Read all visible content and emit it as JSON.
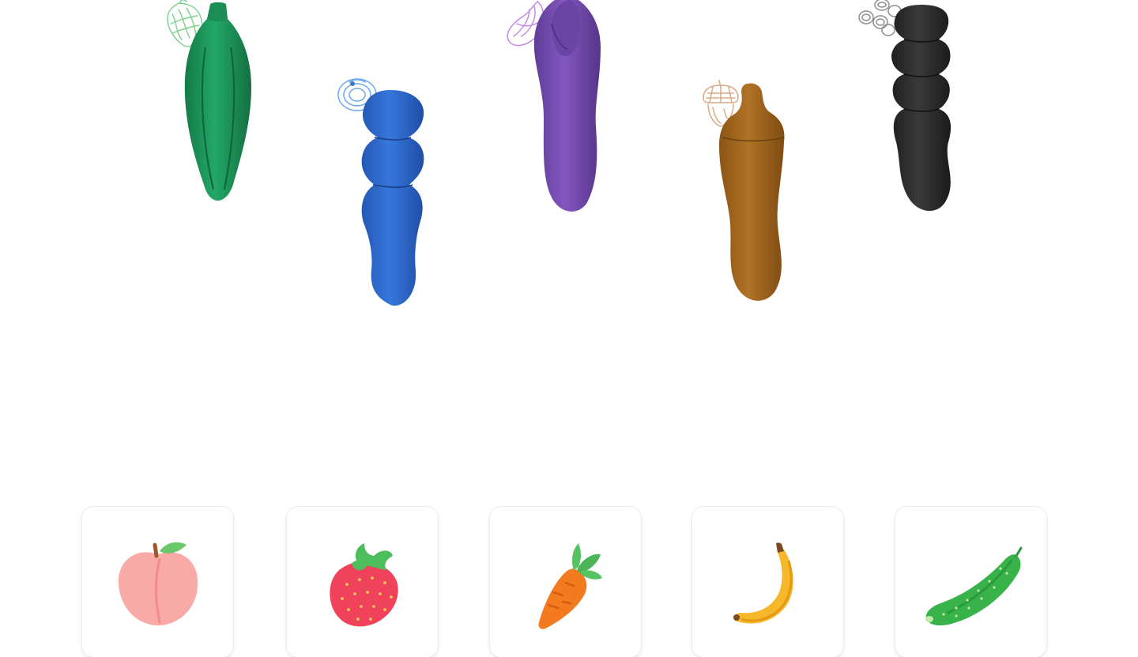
{
  "colors": {
    "green": "#1f9a5f",
    "blue": "#2e6fd1",
    "purple": "#7a4fb0",
    "brown": "#a8691e",
    "black": "#2b2b2b",
    "peach": "#f9a9a6",
    "strawberry": "#f0425a",
    "carrot": "#f47a20",
    "banana": "#f7b72a",
    "cucumber": "#37b34a"
  },
  "products": [
    {
      "icon": "pepper-doodle-icon",
      "color": "green"
    },
    {
      "icon": "blueberry-doodle-icon",
      "color": "blue"
    },
    {
      "icon": "eggplant-doodle-icon",
      "color": "purple"
    },
    {
      "icon": "acorn-doodle-icon",
      "color": "brown"
    },
    {
      "icon": "grapes-doodle-icon",
      "color": "black"
    }
  ],
  "categories": [
    {
      "icon": "peach-icon"
    },
    {
      "icon": "strawberry-icon"
    },
    {
      "icon": "carrot-icon"
    },
    {
      "icon": "banana-icon"
    },
    {
      "icon": "cucumber-icon"
    }
  ]
}
